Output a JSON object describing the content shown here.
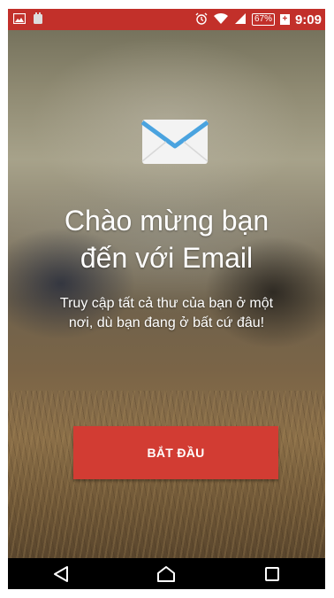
{
  "status_bar": {
    "icons_left": [
      "image-icon",
      "android-debug-icon"
    ],
    "icons_right": [
      "alarm-icon",
      "wifi-icon",
      "signal-icon"
    ],
    "battery_percent": "67%",
    "time": "9:09",
    "color": "#c2302a"
  },
  "welcome": {
    "title_line1": "Chào mừng bạn",
    "title_line2": "đến với Email",
    "subtitle_line1": "Truy cập tất cả thư của bạn ở một",
    "subtitle_line2": "nơi, dù bạn đang ở bất cứ đâu!",
    "icon": "envelope-icon"
  },
  "start_button": {
    "label": "BẮT ĐẦU",
    "color": "#d23c33"
  },
  "nav_bar": {
    "buttons": [
      "back-icon",
      "home-icon",
      "recents-icon"
    ]
  }
}
